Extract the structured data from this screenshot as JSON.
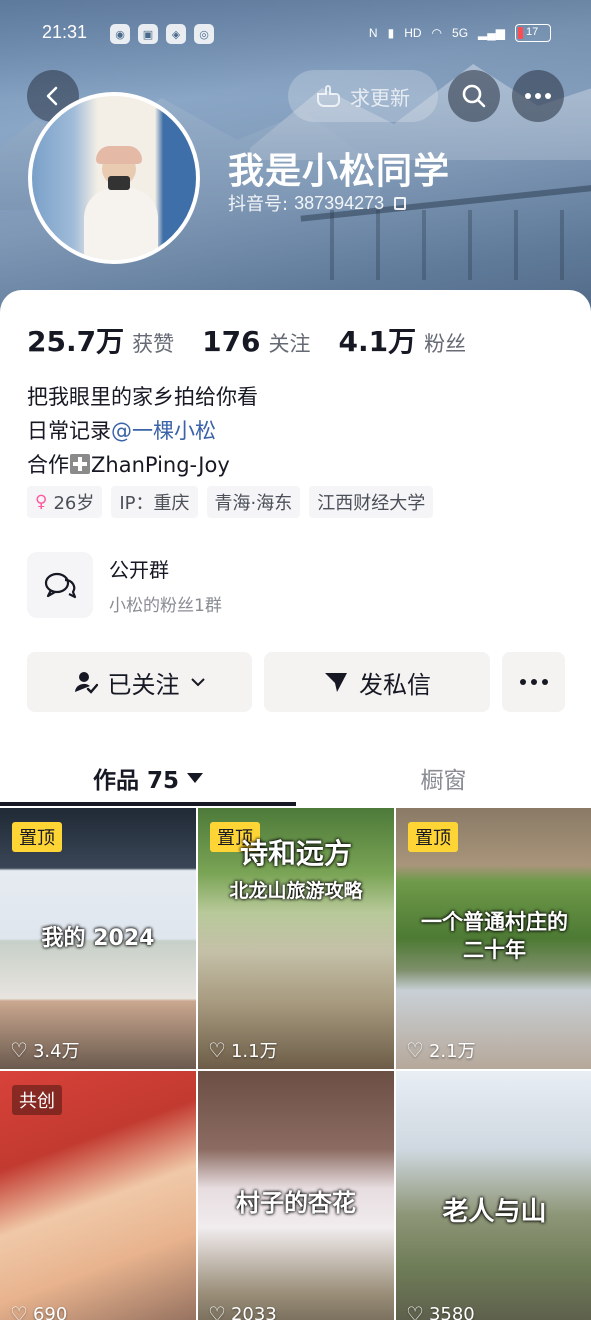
{
  "status_bar": {
    "time": "21:31",
    "network": "5G",
    "battery": "17"
  },
  "header": {
    "update_label": "求更新",
    "nickname": "我是小松同学",
    "douyin_id_label": "抖音号:",
    "douyin_id": "387394273"
  },
  "stats": [
    {
      "num": "25.7万",
      "label": "获赞"
    },
    {
      "num": "176",
      "label": "关注"
    },
    {
      "num": "4.1万",
      "label": "粉丝"
    }
  ],
  "bio": {
    "line1": "把我眼里的家乡拍给你看",
    "line2_prefix": "日常记录",
    "line2_mention": "@一棵小松",
    "line3_prefix": "合作",
    "line3_suffix": "ZhanPing-Joy"
  },
  "tags": {
    "age": "26岁",
    "ip": "IP：重庆",
    "location": "青海·海东",
    "school": "江西财经大学"
  },
  "group": {
    "title": "公开群",
    "subtitle": "小松的粉丝1群"
  },
  "actions": {
    "follow_label": "已关注",
    "message_label": "发私信"
  },
  "tabs": {
    "works_label": "作品 75",
    "window_label": "橱窗"
  },
  "videos": [
    {
      "badge": "置顶",
      "caption": "我的 2024",
      "likes": "3.4万"
    },
    {
      "badge": "置顶",
      "caption": "诗和远方",
      "subcaption": "北龙山旅游攻略",
      "likes": "1.1万"
    },
    {
      "badge": "置顶",
      "caption": "一个普通村庄的",
      "subcaption": "二十年",
      "likes": "2.1万"
    },
    {
      "badge": "共创",
      "caption": "",
      "likes": "690"
    },
    {
      "badge": "",
      "caption": "村子的杏花",
      "likes": "2033"
    },
    {
      "badge": "",
      "caption": "老人与山",
      "likes": "3580"
    }
  ],
  "colors": {
    "mention": "#3a63a8",
    "pin_badge": "#ffd435",
    "female": "#ff5aa0"
  }
}
